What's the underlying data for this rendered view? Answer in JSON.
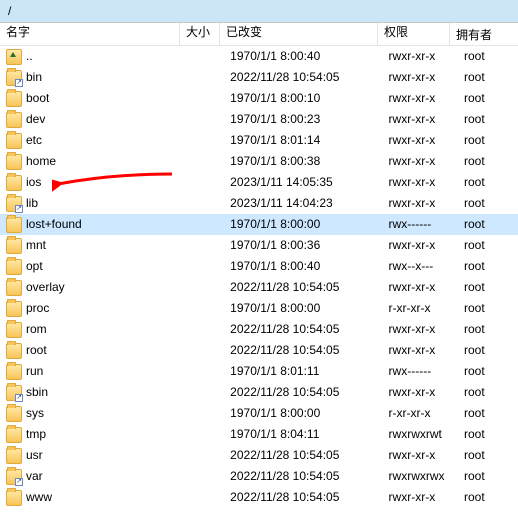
{
  "path": "/",
  "columns": {
    "name": "名字",
    "size": "大小",
    "changed": "已改变",
    "perm": "权限",
    "owner": "拥有者"
  },
  "entries": [
    {
      "name": "..",
      "icon": "folder-up",
      "date": "1970/1/1 8:00:40",
      "perm": "rwxr-xr-x",
      "owner": "root"
    },
    {
      "name": "bin",
      "icon": "folder-link",
      "date": "2022/11/28 10:54:05",
      "perm": "rwxr-xr-x",
      "owner": "root"
    },
    {
      "name": "boot",
      "icon": "folder",
      "date": "1970/1/1 8:00:10",
      "perm": "rwxr-xr-x",
      "owner": "root"
    },
    {
      "name": "dev",
      "icon": "folder",
      "date": "1970/1/1 8:00:23",
      "perm": "rwxr-xr-x",
      "owner": "root"
    },
    {
      "name": "etc",
      "icon": "folder",
      "date": "1970/1/1 8:01:14",
      "perm": "rwxr-xr-x",
      "owner": "root"
    },
    {
      "name": "home",
      "icon": "folder",
      "date": "1970/1/1 8:00:38",
      "perm": "rwxr-xr-x",
      "owner": "root"
    },
    {
      "name": "ios",
      "icon": "folder",
      "date": "2023/1/11 14:05:35",
      "perm": "rwxr-xr-x",
      "owner": "root",
      "annotated": true
    },
    {
      "name": "lib",
      "icon": "folder-link",
      "date": "2023/1/11 14:04:23",
      "perm": "rwxr-xr-x",
      "owner": "root"
    },
    {
      "name": "lost+found",
      "icon": "folder",
      "date": "1970/1/1 8:00:00",
      "perm": "rwx------",
      "owner": "root",
      "selected": true
    },
    {
      "name": "mnt",
      "icon": "folder",
      "date": "1970/1/1 8:00:36",
      "perm": "rwxr-xr-x",
      "owner": "root"
    },
    {
      "name": "opt",
      "icon": "folder",
      "date": "1970/1/1 8:00:40",
      "perm": "rwx--x---",
      "owner": "root"
    },
    {
      "name": "overlay",
      "icon": "folder",
      "date": "2022/11/28 10:54:05",
      "perm": "rwxr-xr-x",
      "owner": "root"
    },
    {
      "name": "proc",
      "icon": "folder",
      "date": "1970/1/1 8:00:00",
      "perm": "r-xr-xr-x",
      "owner": "root"
    },
    {
      "name": "rom",
      "icon": "folder",
      "date": "2022/11/28 10:54:05",
      "perm": "rwxr-xr-x",
      "owner": "root"
    },
    {
      "name": "root",
      "icon": "folder",
      "date": "2022/11/28 10:54:05",
      "perm": "rwxr-xr-x",
      "owner": "root"
    },
    {
      "name": "run",
      "icon": "folder",
      "date": "1970/1/1 8:01:11",
      "perm": "rwx------",
      "owner": "root"
    },
    {
      "name": "sbin",
      "icon": "folder-link",
      "date": "2022/11/28 10:54:05",
      "perm": "rwxr-xr-x",
      "owner": "root"
    },
    {
      "name": "sys",
      "icon": "folder",
      "date": "1970/1/1 8:00:00",
      "perm": "r-xr-xr-x",
      "owner": "root"
    },
    {
      "name": "tmp",
      "icon": "folder",
      "date": "1970/1/1 8:04:11",
      "perm": "rwxrwxrwt",
      "owner": "root"
    },
    {
      "name": "usr",
      "icon": "folder",
      "date": "2022/11/28 10:54:05",
      "perm": "rwxr-xr-x",
      "owner": "root"
    },
    {
      "name": "var",
      "icon": "folder-link",
      "date": "2022/11/28 10:54:05",
      "perm": "rwxrwxrwx",
      "owner": "root"
    },
    {
      "name": "www",
      "icon": "folder",
      "date": "2022/11/28 10:54:05",
      "perm": "rwxr-xr-x",
      "owner": "root"
    }
  ]
}
